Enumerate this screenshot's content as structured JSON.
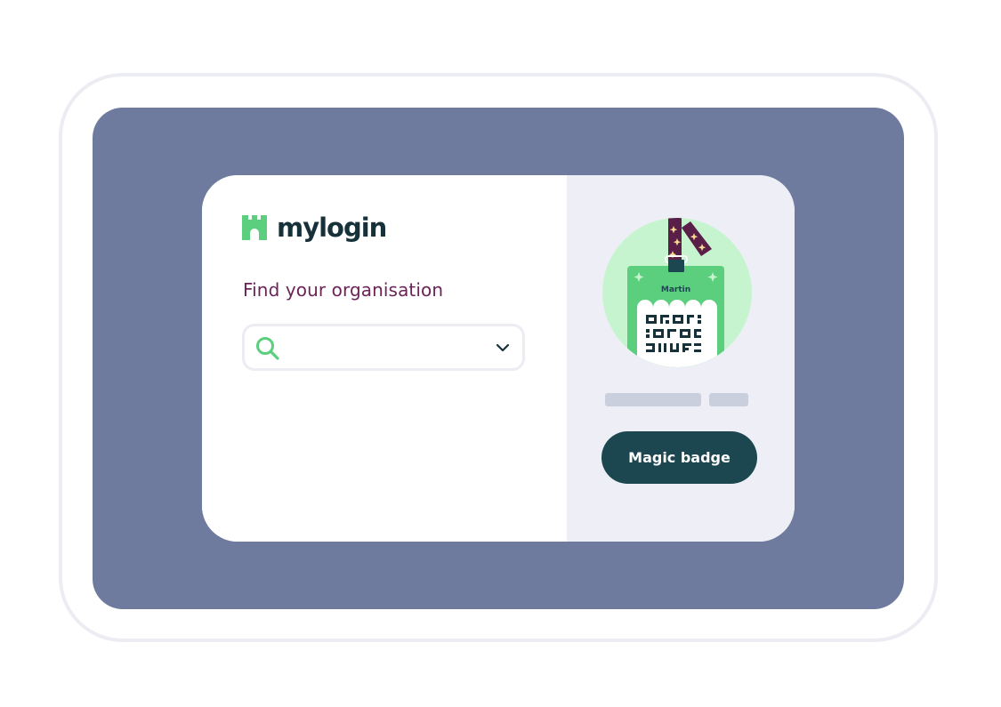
{
  "brand": {
    "name": "mylogin",
    "icon": "castle-icon",
    "color": "#5ccf7f"
  },
  "login": {
    "heading": "Find your organisation",
    "search": {
      "value": "",
      "placeholder": "",
      "search_icon": "search-icon",
      "dropdown_icon": "chevron-down-icon"
    }
  },
  "badge": {
    "name": "Martin",
    "button_label": "Magic badge"
  },
  "colors": {
    "screen_background": "#6e7b9e",
    "heading": "#6b2457",
    "button": "#1c4750",
    "right_panel": "#eeeff6",
    "badge_circle": "#c5f4cf",
    "badge_card": "#5ccf7f",
    "lanyard": "#5a1f49"
  }
}
